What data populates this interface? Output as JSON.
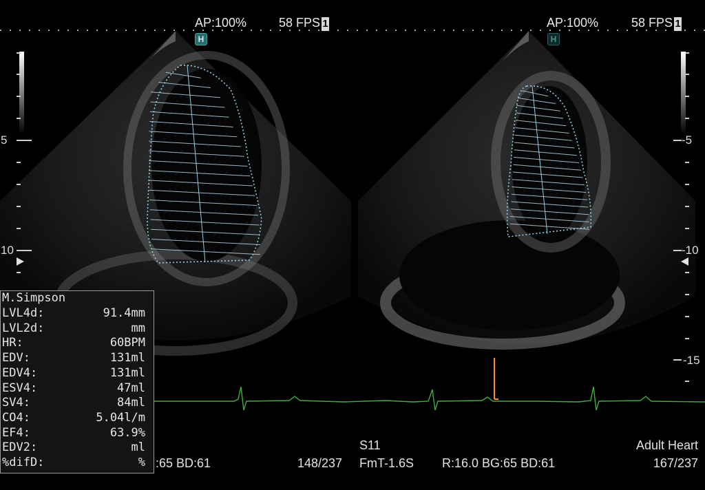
{
  "left_view": {
    "ap": "AP:100%",
    "fps": "58 FPS",
    "frame_box": "1",
    "h_badge": "H",
    "bottom_params": ":65  BD:61",
    "frame_counter": "148/237"
  },
  "right_view": {
    "ap": "AP:100%",
    "fps": "58 FPS",
    "frame_box": "1",
    "h_badge": "H",
    "preset": "S11",
    "probe_mode": "FmT-1.6S",
    "params": "R:16.0  BG:65  BD:61",
    "exam_type": "Adult Heart",
    "frame_counter": "167/237"
  },
  "depth_scale": {
    "left_labels": [
      "5",
      "10"
    ],
    "right_labels": [
      "-5",
      "-10",
      "-15"
    ]
  },
  "measurements": {
    "title": "M.Simpson",
    "rows": [
      {
        "label": "LVL4d:",
        "value": "91.4mm"
      },
      {
        "label": "LVL2d:",
        "value": "mm"
      },
      {
        "label": "HR:",
        "value": "60BPM"
      },
      {
        "label": "EDV:",
        "value": "131ml"
      },
      {
        "label": "EDV4:",
        "value": "131ml"
      },
      {
        "label": "ESV4:",
        "value": "47ml"
      },
      {
        "label": "SV4:",
        "value": "84ml"
      },
      {
        "label": "CO4:",
        "value": "5.04l/m"
      },
      {
        "label": "EF4:",
        "value": "63.9%"
      },
      {
        "label": "EDV2:",
        "value": "ml"
      },
      {
        "label": "%difD:",
        "value": "%"
      }
    ]
  },
  "colors": {
    "trace": "#8fd3ee",
    "ecg": "#3fae3f",
    "cursor": "#ff8c1a",
    "badge": "#3fa6a6"
  }
}
